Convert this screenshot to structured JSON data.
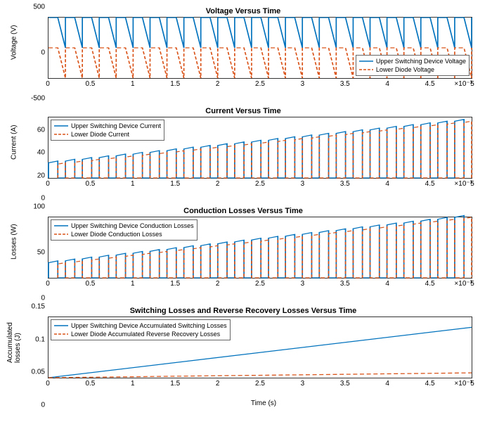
{
  "chart_data": [
    {
      "type": "line",
      "title": "Voltage Versus Time",
      "xlabel": "",
      "ylabel": "Voltage (V)",
      "xlim": [
        0,
        5
      ],
      "ylim": [
        -500,
        500
      ],
      "yticks": [
        -500,
        0,
        500
      ],
      "xticks": [
        0,
        0.5,
        1,
        1.5,
        2,
        2.5,
        3,
        3.5,
        4,
        4.5,
        5
      ],
      "x_exponent": "×10⁻³",
      "legend_pos": "lower-right",
      "pwm_period_ms": 0.2,
      "series": [
        {
          "name": "Upper Switching Device Voltage",
          "color": "#0072BD",
          "style": "solid",
          "shape": "sawtooth_high_to_zero",
          "vhigh": 500,
          "vlow": 0
        },
        {
          "name": "Lower Diode Voltage",
          "color": "#D95319",
          "style": "dashed",
          "shape": "sawtooth_zero_to_low",
          "vhigh": 0,
          "vlow": -500
        }
      ]
    },
    {
      "type": "line",
      "title": "Current Versus Time",
      "xlabel": "",
      "ylabel": "Current (A)",
      "xlim": [
        0,
        5
      ],
      "ylim": [
        0,
        80
      ],
      "yticks": [
        0,
        20,
        40,
        60
      ],
      "xticks": [
        0,
        0.5,
        1,
        1.5,
        2,
        2.5,
        3,
        3.5,
        4,
        4.5,
        5
      ],
      "x_exponent": "×10⁻³",
      "legend_pos": "upper-left",
      "pwm_period_ms": 0.2,
      "envelope_start": 20,
      "envelope_end": 75,
      "series": [
        {
          "name": "Upper Switching Device Current",
          "color": "#0072BD",
          "style": "solid"
        },
        {
          "name": "Lower Diode Current",
          "color": "#D95319",
          "style": "dashed"
        }
      ]
    },
    {
      "type": "line",
      "title": "Conduction Losses Versus Time",
      "xlabel": "",
      "ylabel": "Losses (W)",
      "xlim": [
        0,
        5
      ],
      "ylim": [
        0,
        100
      ],
      "yticks": [
        0,
        50,
        100
      ],
      "xticks": [
        0,
        0.5,
        1,
        1.5,
        2,
        2.5,
        3,
        3.5,
        4,
        4.5,
        5
      ],
      "x_exponent": "×10⁻³",
      "legend_pos": "upper-left",
      "pwm_period_ms": 0.2,
      "envelope_start": 25,
      "envelope_end": 100,
      "series": [
        {
          "name": "Upper Switching Device Conduction Losses",
          "color": "#0072BD",
          "style": "solid"
        },
        {
          "name": "Lower Diode Conduction Losses",
          "color": "#D95319",
          "style": "dashed"
        }
      ]
    },
    {
      "type": "line",
      "title": "Switching Losses and Reverse Recovery Losses Versus Time",
      "xlabel": "Time (s)",
      "ylabel": "Accumulated\nlosses (J)",
      "xlim": [
        0,
        5
      ],
      "ylim": [
        0,
        0.15
      ],
      "yticks": [
        0,
        0.05,
        0.1,
        0.15
      ],
      "xticks": [
        0,
        0.5,
        1,
        1.5,
        2,
        2.5,
        3,
        3.5,
        4,
        4.5,
        5
      ],
      "x_exponent": "×10⁻³",
      "legend_pos": "upper-left",
      "series": [
        {
          "name": "Upper Switching Device Accumulated Switching Losses",
          "color": "#0072BD",
          "style": "solid",
          "points": [
            [
              0,
              0
            ],
            [
              5,
              0.125
            ]
          ]
        },
        {
          "name": "Lower Diode Accumulated Reverse Recovery Losses",
          "color": "#D95319",
          "style": "dashed",
          "points": [
            [
              0,
              0
            ],
            [
              5,
              0.012
            ]
          ]
        }
      ]
    }
  ]
}
